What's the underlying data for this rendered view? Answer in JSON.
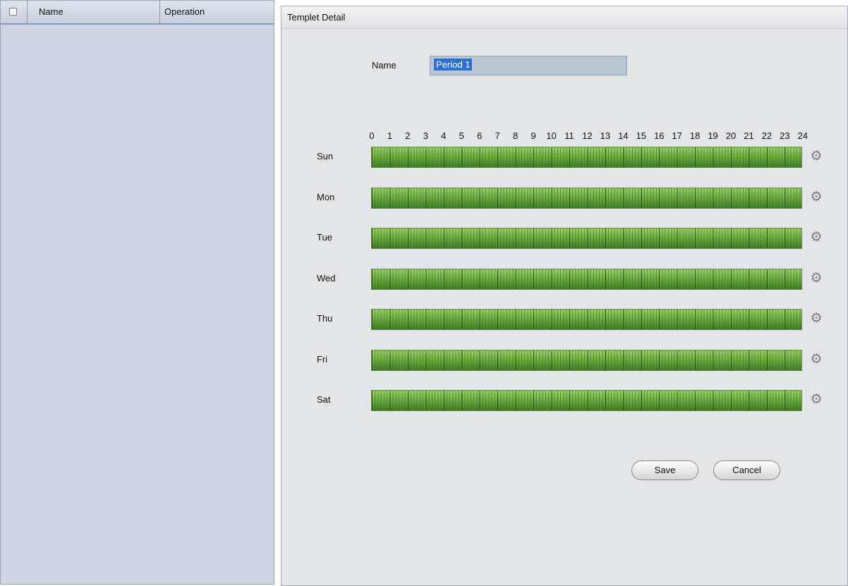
{
  "list": {
    "columns": {
      "name": "Name",
      "operation": "Operation"
    }
  },
  "detail": {
    "title": "Templet Detail",
    "name_label": "Name",
    "name_value": "Period 1",
    "hours": [
      "0",
      "1",
      "2",
      "3",
      "4",
      "5",
      "6",
      "7",
      "8",
      "9",
      "10",
      "11",
      "12",
      "13",
      "14",
      "15",
      "16",
      "17",
      "18",
      "19",
      "20",
      "21",
      "22",
      "23",
      "24"
    ],
    "days": [
      "Sun",
      "Mon",
      "Tue",
      "Wed",
      "Thu",
      "Fri",
      "Sat"
    ],
    "save_label": "Save",
    "cancel_label": "Cancel"
  },
  "icons": {
    "day_settings": "gear-icon"
  },
  "colors": {
    "bar_light": "#9bd06a",
    "bar_dark": "#3f7d24",
    "selection": "#2f6fce"
  }
}
